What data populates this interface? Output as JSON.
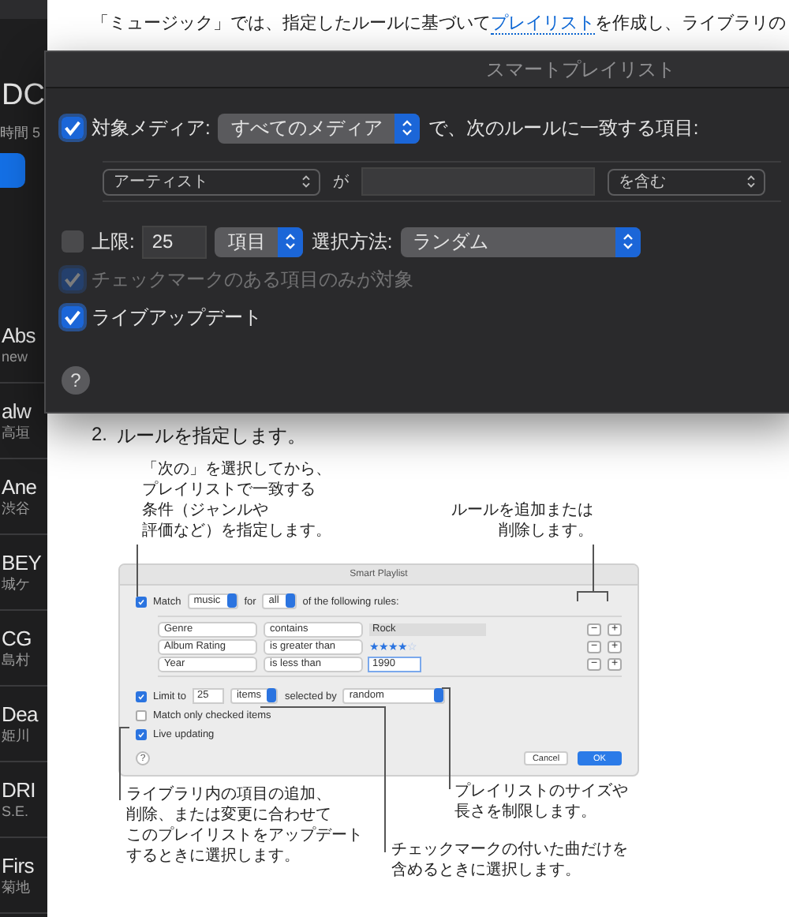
{
  "sidebar": {
    "heading": "DC",
    "subheading": "時間 5",
    "items": [
      {
        "title": "Abs",
        "subtitle": "new"
      },
      {
        "title": "alw",
        "subtitle": "高垣"
      },
      {
        "title": "Ane",
        "subtitle": "渋谷"
      },
      {
        "title": "BEY",
        "subtitle": "城ケ"
      },
      {
        "title": "CG",
        "subtitle": "島村"
      },
      {
        "title": "Dea",
        "subtitle": "姫川"
      },
      {
        "title": "DRI",
        "subtitle": "S.E."
      },
      {
        "title": "Firs",
        "subtitle": "菊地"
      }
    ]
  },
  "article": {
    "intro_before": "「ミュージック」では、指定したルールに基づいて",
    "intro_link": "プレイリスト",
    "intro_after": "を作成し、ライブラリの",
    "step_number": "2.",
    "step_text": "ルールを指定します。"
  },
  "dialog": {
    "title": "スマートプレイリスト",
    "media": {
      "label": "対象メディア:",
      "checked": true,
      "value": "すべてのメディア",
      "suffix": "で、次のルールに一致する項目:"
    },
    "rule": {
      "field": "アーティスト",
      "connector": "が",
      "operator": "を含む"
    },
    "limit": {
      "label": "上限:",
      "checked": false,
      "value": "25",
      "unit": "項目",
      "method_label": "選択方法:",
      "method": "ランダム"
    },
    "checked_only": {
      "label": "チェックマークのある項目のみが対象",
      "checked": true,
      "disabled": true
    },
    "live_update": {
      "label": "ライブアップデート",
      "checked": true,
      "disabled": false
    },
    "help": "?"
  },
  "figure": {
    "callouts": [
      {
        "lines": [
          "「次の」を選択してから、",
          "プレイリストで一致する",
          "条件（ジャンルや",
          "評価など）を指定します。"
        ]
      },
      {
        "lines": [
          "ルールを追加または",
          "削除します。"
        ]
      },
      {
        "lines": [
          "ライブラリ内の項目の追加、",
          "削除、または変更に合わせて",
          "このプレイリストをアップデート",
          "するときに選択します。"
        ]
      },
      {
        "lines": [
          "プレイリストのサイズや",
          "長さを制限します。"
        ]
      },
      {
        "lines": [
          "チェックマークの付いた曲だけを",
          "含めるときに選択します。"
        ]
      }
    ],
    "window": {
      "title": "Smart Playlist",
      "match": {
        "checked": true,
        "label": "Match",
        "media": "music",
        "for": "for",
        "scope": "all",
        "suffix": "of the following rules:"
      },
      "rules": [
        {
          "field": "Genre",
          "operator": "contains",
          "kind": "text",
          "value": "Rock",
          "focused": false,
          "remove": "−",
          "add": "+"
        },
        {
          "field": "Album Rating",
          "operator": "is greater than",
          "kind": "stars",
          "stars": 4,
          "remove": "−",
          "add": "+"
        },
        {
          "field": "Year",
          "operator": "is less than",
          "kind": "text",
          "value": "1990",
          "focused": true,
          "remove": "−",
          "add": "+"
        }
      ],
      "limit": {
        "checked": true,
        "label": "Limit to",
        "value": "25",
        "unit": "items",
        "by": "selected by",
        "method": "random"
      },
      "checked_only": {
        "checked": false,
        "label": "Match only checked items"
      },
      "live": {
        "checked": true,
        "label": "Live updating"
      },
      "help": "?",
      "buttons": [
        {
          "label": "Cancel",
          "kind": "secondary"
        },
        {
          "label": "OK",
          "kind": "primary"
        }
      ]
    }
  }
}
